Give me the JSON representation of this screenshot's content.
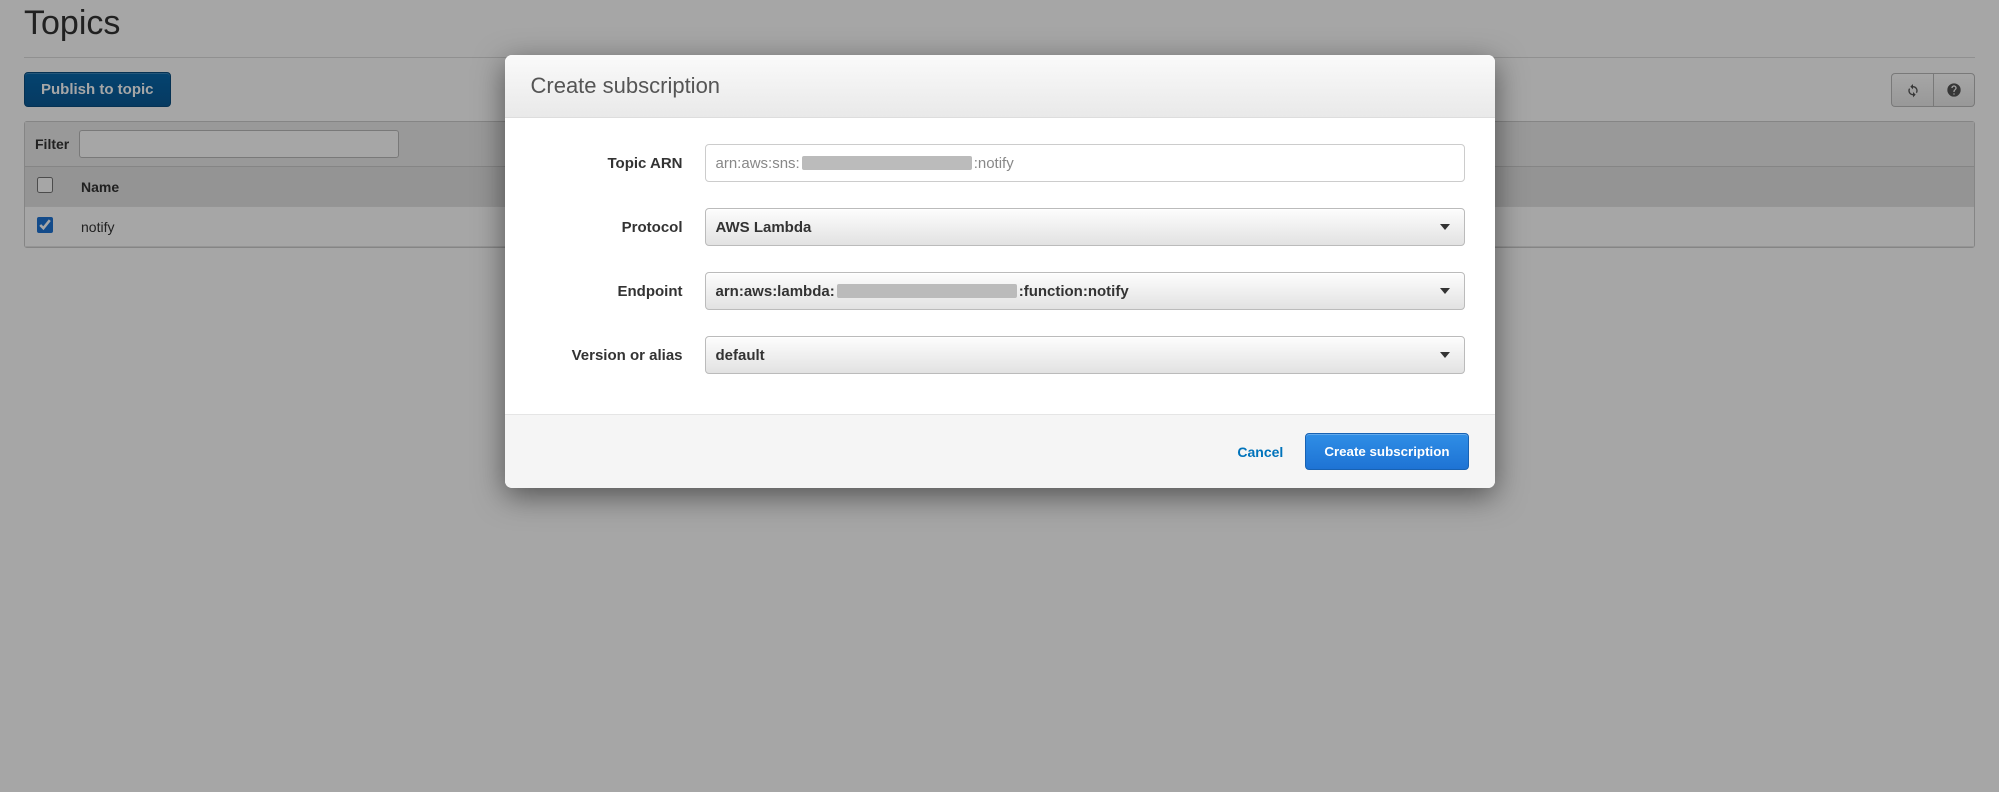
{
  "page": {
    "title": "Topics",
    "publish_button": "Publish to topic",
    "filter_label": "Filter",
    "filter_value": ""
  },
  "table": {
    "columns": {
      "name": "Name"
    },
    "rows": [
      {
        "checked": true,
        "name": "notify"
      }
    ]
  },
  "dialog": {
    "title": "Create subscription",
    "labels": {
      "topic_arn": "Topic ARN",
      "protocol": "Protocol",
      "endpoint": "Endpoint",
      "version": "Version or alias"
    },
    "values": {
      "topic_arn_prefix": "arn:aws:sns:",
      "topic_arn_suffix": ":notify",
      "protocol": "AWS Lambda",
      "endpoint_prefix": "arn:aws:lambda:",
      "endpoint_suffix": ":function:notify",
      "version": "default"
    },
    "buttons": {
      "cancel": "Cancel",
      "submit": "Create subscription"
    }
  }
}
